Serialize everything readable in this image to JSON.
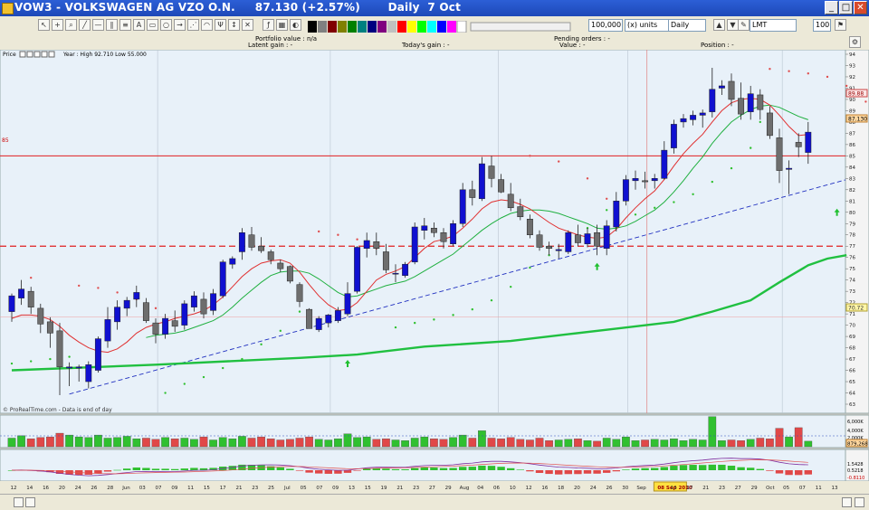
{
  "window": {
    "title": "VOW3 - VOLKSWAGEN AG VZO O.N.     87.130 (+2.57%)       Daily  7 Oct",
    "minimize_label": "_",
    "maximize_label": "□",
    "close_label": "✕"
  },
  "toolbar": {
    "quantity_value": "100,000",
    "units_value": "(x) units",
    "timeframe_value": "Daily",
    "order_type_value": "LMT",
    "price_qty_value": "100"
  },
  "infobar": {
    "portfolio_value": "Portfolio value : n/a",
    "latent_gain": "Latent gain : -",
    "todays_gain": "Today's gain : -",
    "pending_orders": "Pending orders : -",
    "value": "Value : -",
    "position": "Position : -"
  },
  "price_panel": {
    "label": "Price",
    "year_info": "Year : High 92.710 Low 55.000",
    "credit": "© ProRealTime.com - Data is end of day",
    "level_left_label": "85",
    "current_price_label": "87.130",
    "upper_label": "89.88",
    "lower_label": "70.72",
    "y_ticks": [
      "94",
      "93",
      "92",
      "91",
      "90",
      "89",
      "88",
      "87",
      "86",
      "85",
      "84",
      "83",
      "82",
      "81",
      "80",
      "79",
      "78",
      "77",
      "76",
      "75",
      "74",
      "73",
      "72",
      "71",
      "70",
      "69",
      "68",
      "67",
      "66",
      "65",
      "64",
      "63"
    ]
  },
  "volume_panel": {
    "y_ticks": [
      "6,000K",
      "4,000K",
      "2,000K"
    ],
    "last_label": "879,268"
  },
  "macd_panel": {
    "y_ticks": [
      "1.5428",
      "0.5218",
      "-0.8110"
    ]
  },
  "x_axis": {
    "labels": [
      "12",
      "14",
      "16",
      "20",
      "24",
      "26",
      "28",
      "Jun",
      "03",
      "07",
      "09",
      "11",
      "15",
      "17",
      "21",
      "23",
      "25",
      "Jul",
      "05",
      "07",
      "09",
      "13",
      "15",
      "19",
      "21",
      "23",
      "27",
      "29",
      "Aug",
      "04",
      "06",
      "10",
      "12",
      "16",
      "18",
      "20",
      "24",
      "26",
      "30",
      "Sep",
      "08 Sep 2010",
      "13",
      "17",
      "21",
      "23",
      "27",
      "29",
      "Oct",
      "05",
      "07",
      "11",
      "13"
    ],
    "highlight_label": "08 Sep 2010"
  },
  "colors": {
    "background": "#e8f1f9",
    "up_candle": "#1010d0",
    "down_candle": "#6e6e6e",
    "ma_short": "#e03030",
    "ma_mid": "#20b040",
    "ma_long": "#20c040",
    "sar_up": "#30c030",
    "sar_down": "#e05050",
    "resistance": "#e02020",
    "trendline": "#2030c0",
    "vol_up": "#30c030",
    "vol_down": "#e04848"
  },
  "chart_data": {
    "type": "candlestick",
    "symbol": "VOW3",
    "ylim": [
      63,
      94
    ],
    "candles": [
      [
        71.2,
        72.8,
        70.3,
        72.6
      ],
      [
        72.4,
        74.0,
        71.8,
        73.2
      ],
      [
        73.0,
        73.4,
        71.0,
        71.6
      ],
      [
        71.5,
        71.9,
        69.3,
        70.1
      ],
      [
        70.3,
        70.7,
        68.0,
        69.3
      ],
      [
        69.5,
        70.2,
        63.8,
        66.3
      ],
      [
        66.2,
        66.7,
        64.6,
        66.3
      ],
      [
        66.2,
        66.5,
        65.0,
        66.3
      ],
      [
        65.0,
        66.8,
        64.4,
        66.5
      ],
      [
        66.0,
        69.0,
        65.8,
        68.8
      ],
      [
        68.6,
        71.6,
        68.0,
        70.5
      ],
      [
        70.3,
        72.2,
        69.6,
        71.6
      ],
      [
        71.5,
        72.5,
        70.8,
        72.2
      ],
      [
        72.3,
        73.5,
        71.6,
        72.9
      ],
      [
        72.0,
        72.4,
        70.2,
        70.4
      ],
      [
        70.2,
        70.6,
        68.4,
        69.2
      ],
      [
        69.2,
        71.0,
        68.8,
        70.6
      ],
      [
        70.4,
        71.3,
        69.4,
        69.9
      ],
      [
        70.0,
        72.2,
        69.6,
        71.9
      ],
      [
        71.6,
        73.0,
        71.2,
        72.6
      ],
      [
        72.3,
        72.9,
        70.6,
        71.0
      ],
      [
        71.3,
        73.2,
        70.9,
        72.8
      ],
      [
        72.6,
        75.8,
        72.4,
        75.6
      ],
      [
        75.4,
        76.1,
        75.0,
        75.9
      ],
      [
        76.5,
        78.6,
        75.8,
        78.2
      ],
      [
        78.0,
        78.7,
        76.6,
        76.9
      ],
      [
        77.0,
        77.8,
        76.4,
        76.6
      ],
      [
        76.5,
        76.7,
        75.4,
        75.8
      ],
      [
        75.5,
        75.8,
        74.7,
        75.0
      ],
      [
        75.2,
        75.3,
        73.7,
        73.9
      ],
      [
        73.6,
        73.8,
        71.6,
        72.1
      ],
      [
        71.4,
        71.5,
        70.5,
        69.7
      ],
      [
        69.6,
        70.8,
        69.4,
        70.6
      ],
      [
        70.2,
        71.0,
        69.8,
        70.9
      ],
      [
        70.4,
        71.6,
        70.2,
        71.3
      ],
      [
        71.0,
        73.8,
        70.8,
        72.8
      ],
      [
        73.0,
        77.0,
        72.8,
        76.9
      ],
      [
        76.8,
        78.2,
        76.0,
        77.5
      ],
      [
        77.4,
        78.2,
        76.2,
        76.8
      ],
      [
        76.5,
        77.2,
        74.6,
        74.9
      ],
      [
        74.6,
        75.4,
        73.8,
        74.6
      ],
      [
        74.4,
        75.6,
        74.2,
        75.4
      ],
      [
        75.6,
        79.1,
        75.4,
        78.7
      ],
      [
        78.4,
        79.5,
        77.6,
        78.8
      ],
      [
        78.6,
        79.1,
        77.8,
        78.2
      ],
      [
        78.2,
        78.6,
        76.8,
        77.4
      ],
      [
        77.2,
        79.3,
        77.0,
        79.0
      ],
      [
        79.0,
        82.6,
        78.7,
        82.0
      ],
      [
        82.0,
        82.8,
        80.6,
        81.3
      ],
      [
        81.2,
        84.9,
        81.0,
        84.3
      ],
      [
        84.1,
        85.0,
        82.2,
        83.0
      ],
      [
        82.9,
        83.4,
        81.7,
        81.8
      ],
      [
        81.6,
        82.6,
        80.1,
        80.4
      ],
      [
        80.5,
        81.2,
        79.3,
        79.6
      ],
      [
        79.4,
        79.8,
        77.7,
        78.0
      ],
      [
        78.0,
        78.4,
        76.6,
        76.9
      ],
      [
        77.0,
        77.4,
        76.2,
        76.8
      ],
      [
        76.6,
        77.2,
        75.9,
        76.7
      ],
      [
        76.5,
        78.4,
        76.3,
        78.2
      ],
      [
        78.0,
        78.9,
        77.0,
        77.3
      ],
      [
        77.2,
        78.6,
        76.9,
        78.1
      ],
      [
        78.2,
        78.9,
        76.2,
        77.0
      ],
      [
        76.8,
        79.3,
        76.2,
        78.8
      ],
      [
        78.7,
        81.8,
        78.3,
        81.0
      ],
      [
        81.0,
        83.3,
        80.6,
        82.9
      ],
      [
        82.8,
        83.7,
        82.0,
        83.0
      ],
      [
        82.8,
        83.6,
        82.1,
        82.7
      ],
      [
        82.8,
        83.4,
        82.1,
        83.0
      ],
      [
        83.0,
        86.3,
        82.9,
        85.5
      ],
      [
        85.7,
        88.2,
        85.2,
        87.8
      ],
      [
        88.0,
        88.7,
        87.5,
        88.3
      ],
      [
        88.2,
        89.0,
        87.7,
        88.6
      ],
      [
        88.6,
        89.1,
        87.5,
        88.8
      ],
      [
        88.9,
        92.8,
        88.4,
        90.9
      ],
      [
        91.0,
        91.7,
        90.4,
        91.2
      ],
      [
        91.6,
        92.3,
        89.4,
        90.0
      ],
      [
        90.1,
        91.5,
        88.2,
        88.7
      ],
      [
        88.9,
        91.2,
        88.2,
        90.5
      ],
      [
        90.4,
        90.9,
        88.2,
        89.1
      ],
      [
        88.8,
        89.4,
        86.5,
        86.8
      ],
      [
        86.6,
        87.4,
        82.6,
        83.7
      ],
      [
        83.8,
        84.6,
        81.6,
        83.9
      ],
      [
        86.2,
        87.0,
        84.9,
        85.8
      ],
      [
        85.3,
        88.0,
        84.3,
        87.1
      ]
    ],
    "ma_short": [
      70.6,
      70.9,
      70.9,
      70.8,
      70.5,
      69.9,
      69.1,
      68.5,
      68.0,
      67.7,
      67.6,
      67.9,
      68.5,
      69.3,
      69.8,
      70.1,
      70.3,
      70.6,
      70.8,
      71.0,
      71.3,
      71.8,
      72.5,
      73.4,
      74.3,
      75.0,
      75.5,
      75.7,
      75.8,
      75.5,
      74.7,
      73.6,
      72.6,
      71.8,
      71.3,
      71.4,
      72.0,
      73.0,
      74.0,
      74.5,
      74.8,
      75.2,
      76.0,
      76.8,
      77.4,
      77.6,
      77.9,
      78.6,
      79.4,
      80.3,
      80.9,
      81.1,
      81.0,
      80.7,
      80.3,
      79.7,
      79.1,
      78.6,
      78.3,
      78.0,
      77.8,
      77.7,
      77.8,
      78.5,
      79.5,
      80.4,
      81.2,
      81.9,
      82.9,
      84.1,
      85.2,
      86.1,
      86.9,
      88.0,
      89.0,
      89.7,
      90.0,
      90.1,
      90.0,
      89.5,
      88.6,
      87.6,
      86.8,
      86.9
    ],
    "ma_mid": [
      null,
      null,
      null,
      null,
      null,
      null,
      null,
      null,
      null,
      null,
      null,
      null,
      null,
      null,
      68.9,
      69.1,
      69.2,
      69.3,
      69.5,
      69.8,
      70.1,
      70.4,
      70.9,
      71.6,
      72.4,
      73.1,
      73.8,
      74.4,
      74.7,
      74.8,
      74.8,
      74.6,
      74.1,
      73.5,
      72.9,
      72.5,
      72.6,
      72.9,
      73.2,
      73.5,
      73.7,
      73.9,
      74.3,
      74.8,
      75.3,
      75.8,
      76.3,
      77.0,
      77.7,
      78.4,
      79.0,
      79.5,
      79.9,
      80.1,
      80.2,
      80.2,
      80.1,
      79.9,
      79.6,
      79.3,
      79.0,
      78.6,
      78.5,
      78.6,
      78.8,
      79.2,
      79.7,
      80.2,
      80.9,
      81.8,
      82.8,
      83.9,
      84.9,
      86.1,
      87.1,
      88.0,
      88.6,
      89.1,
      89.4,
      89.5,
      89.3,
      88.9,
      88.5,
      88.2
    ],
    "ma_long_points": [
      [
        0,
        66.0
      ],
      [
        15,
        66.5
      ],
      [
        30,
        67.1
      ],
      [
        36,
        67.4
      ],
      [
        43,
        68.1
      ],
      [
        52,
        68.6
      ],
      [
        58,
        69.2
      ],
      [
        63,
        69.7
      ],
      [
        69,
        70.3
      ],
      [
        73,
        71.2
      ],
      [
        77,
        72.2
      ],
      [
        80,
        73.8
      ],
      [
        83,
        75.3
      ],
      [
        85,
        75.9
      ],
      [
        87,
        76.2
      ]
    ],
    "sar": [
      [
        0,
        66.6,
        "up"
      ],
      [
        2,
        66.8,
        "up"
      ],
      [
        4,
        67.0,
        "up"
      ],
      [
        6,
        67.2,
        "up"
      ],
      [
        2,
        74.2,
        "down"
      ],
      [
        7,
        73.5,
        "down"
      ],
      [
        9,
        73.3,
        "down"
      ],
      [
        11,
        72.9,
        "down"
      ],
      [
        13,
        72.3,
        "down"
      ],
      [
        15,
        71.5,
        "down"
      ],
      [
        16,
        64.0,
        "up"
      ],
      [
        18,
        64.8,
        "up"
      ],
      [
        20,
        65.4,
        "up"
      ],
      [
        22,
        66.2,
        "up"
      ],
      [
        24,
        67.0,
        "up"
      ],
      [
        26,
        68.3,
        "up"
      ],
      [
        28,
        69.5,
        "up"
      ],
      [
        30,
        71.2,
        "up"
      ],
      [
        32,
        78.3,
        "down"
      ],
      [
        34,
        78.0,
        "down"
      ],
      [
        36,
        77.6,
        "down"
      ],
      [
        38,
        76.8,
        "down"
      ],
      [
        39,
        75.8,
        "down"
      ],
      [
        40,
        69.8,
        "up"
      ],
      [
        42,
        70.2,
        "up"
      ],
      [
        44,
        70.5,
        "up"
      ],
      [
        46,
        70.9,
        "up"
      ],
      [
        48,
        71.4,
        "up"
      ],
      [
        50,
        72.2,
        "up"
      ],
      [
        52,
        73.4,
        "up"
      ],
      [
        54,
        75.1,
        "up"
      ],
      [
        56,
        76.2,
        "up"
      ],
      [
        58,
        77.0,
        "up"
      ],
      [
        60,
        78.6,
        "up"
      ],
      [
        62,
        80.2,
        "up"
      ],
      [
        54,
        85.0,
        "down"
      ],
      [
        57,
        84.5,
        "down"
      ],
      [
        60,
        83.0,
        "down"
      ],
      [
        62,
        81.2,
        "down"
      ],
      [
        63,
        78.6,
        "up"
      ],
      [
        65,
        79.8,
        "up"
      ],
      [
        67,
        80.4,
        "up"
      ],
      [
        69,
        80.9,
        "up"
      ],
      [
        71,
        81.6,
        "up"
      ],
      [
        73,
        82.7,
        "up"
      ],
      [
        75,
        83.9,
        "up"
      ],
      [
        77,
        85.7,
        "up"
      ],
      [
        78,
        88.0,
        "up"
      ],
      [
        79,
        92.7,
        "down"
      ],
      [
        81,
        92.5,
        "down"
      ],
      [
        83,
        92.3,
        "down"
      ],
      [
        85,
        92.0,
        "down"
      ],
      [
        87,
        91.2,
        "down"
      ],
      [
        89,
        89.8,
        "down"
      ]
    ],
    "resistance_level": 85.0,
    "dashed_support_level": 77.0,
    "trendline": [
      [
        6,
        63.9
      ],
      [
        87,
        82.9
      ]
    ],
    "buy_arrows": [
      [
        35,
        66.6
      ],
      [
        61,
        75.2
      ],
      [
        86,
        80.0
      ]
    ],
    "volume_millions": [
      1.4,
      1.8,
      1.3,
      1.5,
      1.6,
      2.2,
      1.9,
      1.6,
      1.5,
      1.9,
      1.4,
      1.5,
      1.7,
      1.3,
      1.4,
      1.2,
      1.5,
      1.3,
      1.4,
      1.2,
      1.6,
      1.1,
      1.5,
      1.3,
      1.7,
      1.4,
      1.6,
      1.3,
      1.1,
      1.2,
      1.4,
      1.6,
      1.2,
      1.1,
      1.3,
      2.1,
      1.5,
      1.6,
      1.2,
      1.3,
      1.1,
      1.0,
      1.4,
      1.6,
      1.3,
      1.2,
      1.5,
      1.9,
      1.4,
      2.6,
      1.4,
      1.3,
      1.5,
      1.2,
      1.1,
      1.4,
      1.0,
      1.1,
      1.2,
      1.3,
      1.0,
      0.9,
      1.4,
      1.2,
      1.6,
      1.0,
      1.1,
      1.2,
      1.1,
      1.3,
      1.0,
      1.2,
      1.1,
      4.9,
      1.0,
      1.1,
      1.0,
      1.2,
      1.4,
      1.3,
      3.0,
      1.6,
      3.1,
      0.9
    ]
  }
}
